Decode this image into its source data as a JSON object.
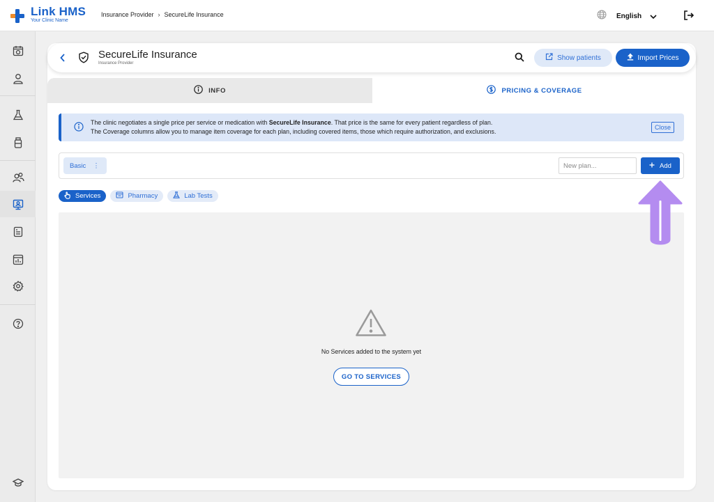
{
  "app": {
    "name": "Link HMS",
    "subtitle": "Your Clinic Name"
  },
  "breadcrumb": {
    "parent": "Insurance Provider",
    "separator": "›",
    "current": "SecureLife Insurance"
  },
  "topbar": {
    "language": "English",
    "globe_icon": "globe-icon",
    "logout_icon": "logout-icon"
  },
  "sidebar": {
    "items": [
      {
        "icon": "calendar-icon"
      },
      {
        "icon": "user-icon"
      },
      {
        "icon": "flask-icon"
      },
      {
        "icon": "medicine-bottle-icon"
      },
      {
        "icon": "users-icon"
      },
      {
        "icon": "monitor-icon",
        "active": true
      },
      {
        "icon": "report-icon"
      },
      {
        "icon": "chart-icon"
      },
      {
        "icon": "settings-icon"
      },
      {
        "icon": "help-icon"
      },
      {
        "icon": "graduation-cap-icon"
      }
    ]
  },
  "header": {
    "title": "SecureLife Insurance",
    "subtitle": "Insurance Provider",
    "show_patients_label": "Show patients",
    "import_prices_label": "Import Prices"
  },
  "tabs": {
    "info_label": "INFO",
    "pricing_label": "PRICING & COVERAGE",
    "active": "pricing"
  },
  "alert": {
    "line1_pre": "The clinic negotiates a single price per service or medication with ",
    "line1_bold": "SecureLife Insurance",
    "line1_post": ". That price is the same for every patient regardless of plan.",
    "line2": "The Coverage columns allow you to manage item coverage for each plan, including covered items, those which require authorization, and exclusions.",
    "close_label": "Close"
  },
  "plans": {
    "items": [
      {
        "label": "Basic",
        "menu": "⋮"
      }
    ],
    "new_plan_placeholder": "New plan...",
    "add_label": "Add"
  },
  "filters": {
    "items": [
      {
        "label": "Services",
        "icon": "hand-icon",
        "active": true
      },
      {
        "label": "Pharmacy",
        "icon": "pharmacy-icon",
        "active": false
      },
      {
        "label": "Lab Tests",
        "icon": "flask-icon",
        "active": false
      }
    ]
  },
  "empty_state": {
    "message": "No Services added to the system yet",
    "button_label": "GO TO SERVICES"
  },
  "colors": {
    "primary": "#1a62c9",
    "light_primary": "#dfe9f8",
    "annotation_arrow": "#b48cf0"
  }
}
